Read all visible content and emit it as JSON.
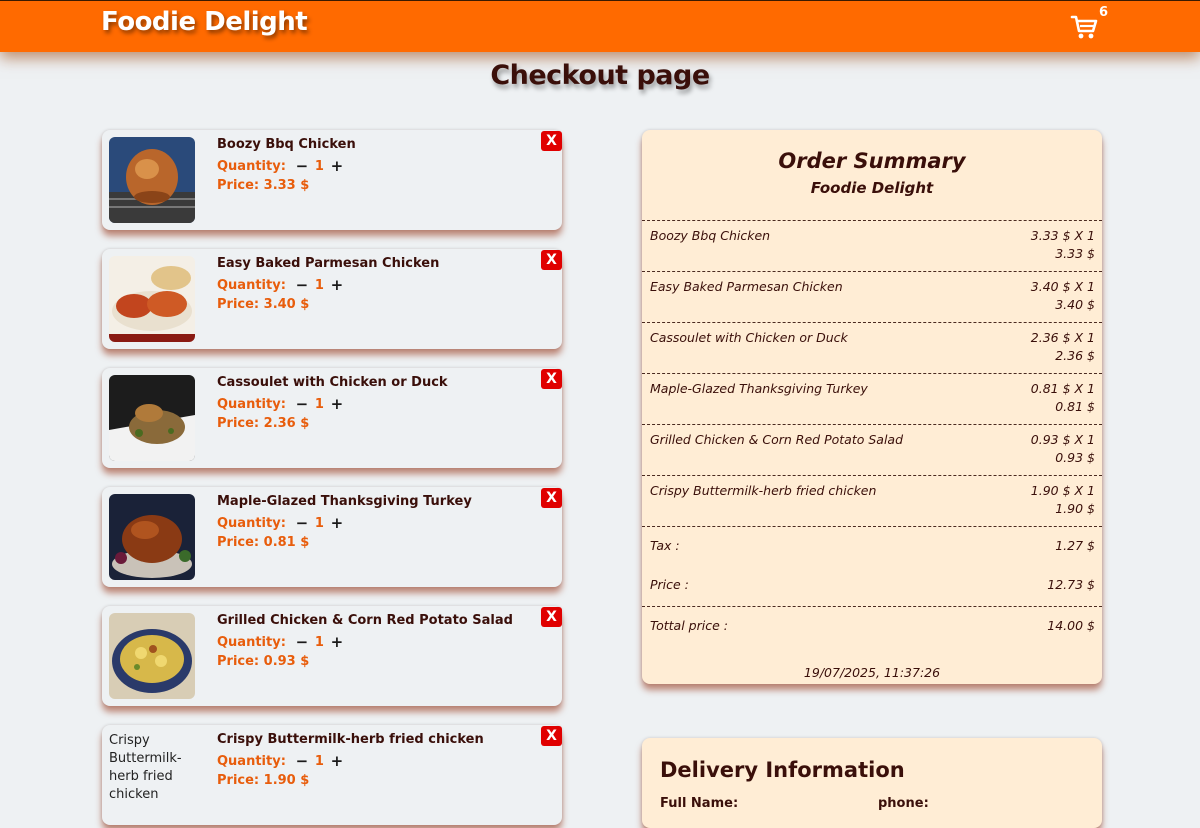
{
  "header": {
    "brand": "Foodie Delight",
    "cart_count": "6",
    "cart_icon": "shopping-cart-icon"
  },
  "page_title": "Checkout page",
  "labels": {
    "quantity": "Quantity:",
    "price_prefix": "Price: ",
    "remove": "X",
    "minus": "−",
    "plus": "+"
  },
  "cart_items": [
    {
      "name": "Boozy Bbq Chicken",
      "qty": "1",
      "price": "3.33 $",
      "image": "roast-chicken"
    },
    {
      "name": "Easy Baked Parmesan Chicken",
      "qty": "1",
      "price": "3.40 $",
      "image": "parmesan-chicken"
    },
    {
      "name": "Cassoulet with Chicken or Duck",
      "qty": "1",
      "price": "2.36 $",
      "image": "cassoulet"
    },
    {
      "name": "Maple-Glazed Thanksgiving Turkey",
      "qty": "1",
      "price": "0.81 $",
      "image": "turkey"
    },
    {
      "name": "Grilled Chicken & Corn Red Potato Salad",
      "qty": "1",
      "price": "0.93 $",
      "image": "potato-salad"
    },
    {
      "name": "Crispy Buttermilk-herb fried chicken",
      "qty": "1",
      "price": "1.90 $",
      "image_alt": "Crispy Buttermilk-herb fried chicken"
    }
  ],
  "summary": {
    "title": "Order Summary",
    "subtitle": "Foodie Delight",
    "lines": [
      {
        "name": "Boozy Bbq Chicken",
        "unit": "3.33 $ X 1",
        "total": "3.33 $"
      },
      {
        "name": "Easy Baked Parmesan Chicken",
        "unit": "3.40 $ X 1",
        "total": "3.40 $"
      },
      {
        "name": "Cassoulet with Chicken or Duck",
        "unit": "2.36 $ X 1",
        "total": "2.36 $"
      },
      {
        "name": "Maple-Glazed Thanksgiving Turkey",
        "unit": "0.81 $ X 1",
        "total": "0.81 $"
      },
      {
        "name": "Grilled Chicken & Corn Red Potato Salad",
        "unit": "0.93 $ X 1",
        "total": "0.93 $"
      },
      {
        "name": "Crispy Buttermilk-herb fried chicken",
        "unit": "1.90 $ X 1",
        "total": "1.90 $"
      }
    ],
    "tax_label": "Tax :",
    "tax_value": "1.27 $",
    "price_label": "Price :",
    "price_value": "12.73 $",
    "total_label": "Tottal price :",
    "total_value": "14.00 $",
    "date": "19/07/2025, 11:37:26"
  },
  "delivery": {
    "title": "Delivery Information",
    "full_name_label": "Full Name:",
    "phone_label": "phone:"
  },
  "colors": {
    "header": "#ff6a00",
    "accent": "#e85d0c",
    "dark_text": "#3a0f0a",
    "remove": "#e00000",
    "summary_bg": "#ffedd5"
  }
}
